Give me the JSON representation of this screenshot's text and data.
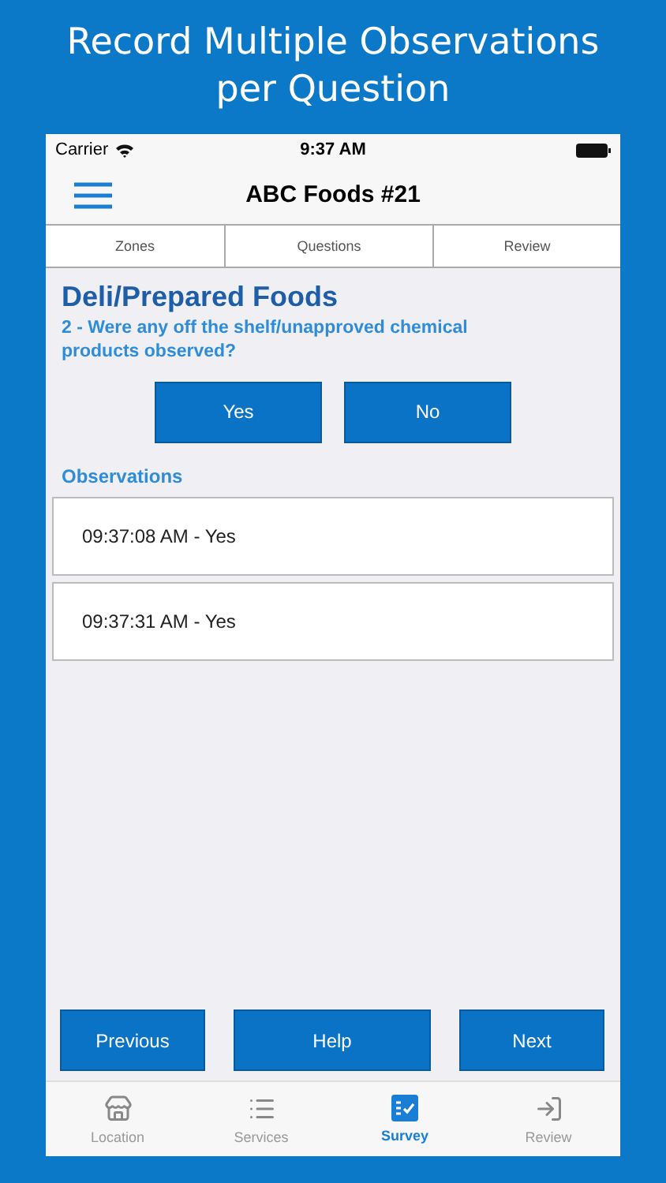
{
  "headline": "Record Multiple Observations per Question",
  "status_bar": {
    "carrier": "Carrier",
    "time": "9:37 AM"
  },
  "nav": {
    "title": "ABC Foods #21"
  },
  "segments": [
    {
      "label": "Zones"
    },
    {
      "label": "Questions"
    },
    {
      "label": "Review"
    }
  ],
  "zone": "Deli/Prepared Foods",
  "question": "2 - Were any off the shelf/unapproved chemical products observed?",
  "answers": [
    "Yes",
    "No"
  ],
  "observations_label": "Observations",
  "observations": [
    "09:37:08 AM - Yes",
    "09:37:31 AM - Yes"
  ],
  "actions": [
    "Previous",
    "Help",
    "Next"
  ],
  "tab_bar": [
    {
      "kind": "store",
      "label": "Location",
      "selected": false
    },
    {
      "kind": "list",
      "label": "Services",
      "selected": false
    },
    {
      "kind": "survey",
      "label": "Survey",
      "selected": true
    },
    {
      "kind": "exit",
      "label": "Review",
      "selected": false
    }
  ]
}
